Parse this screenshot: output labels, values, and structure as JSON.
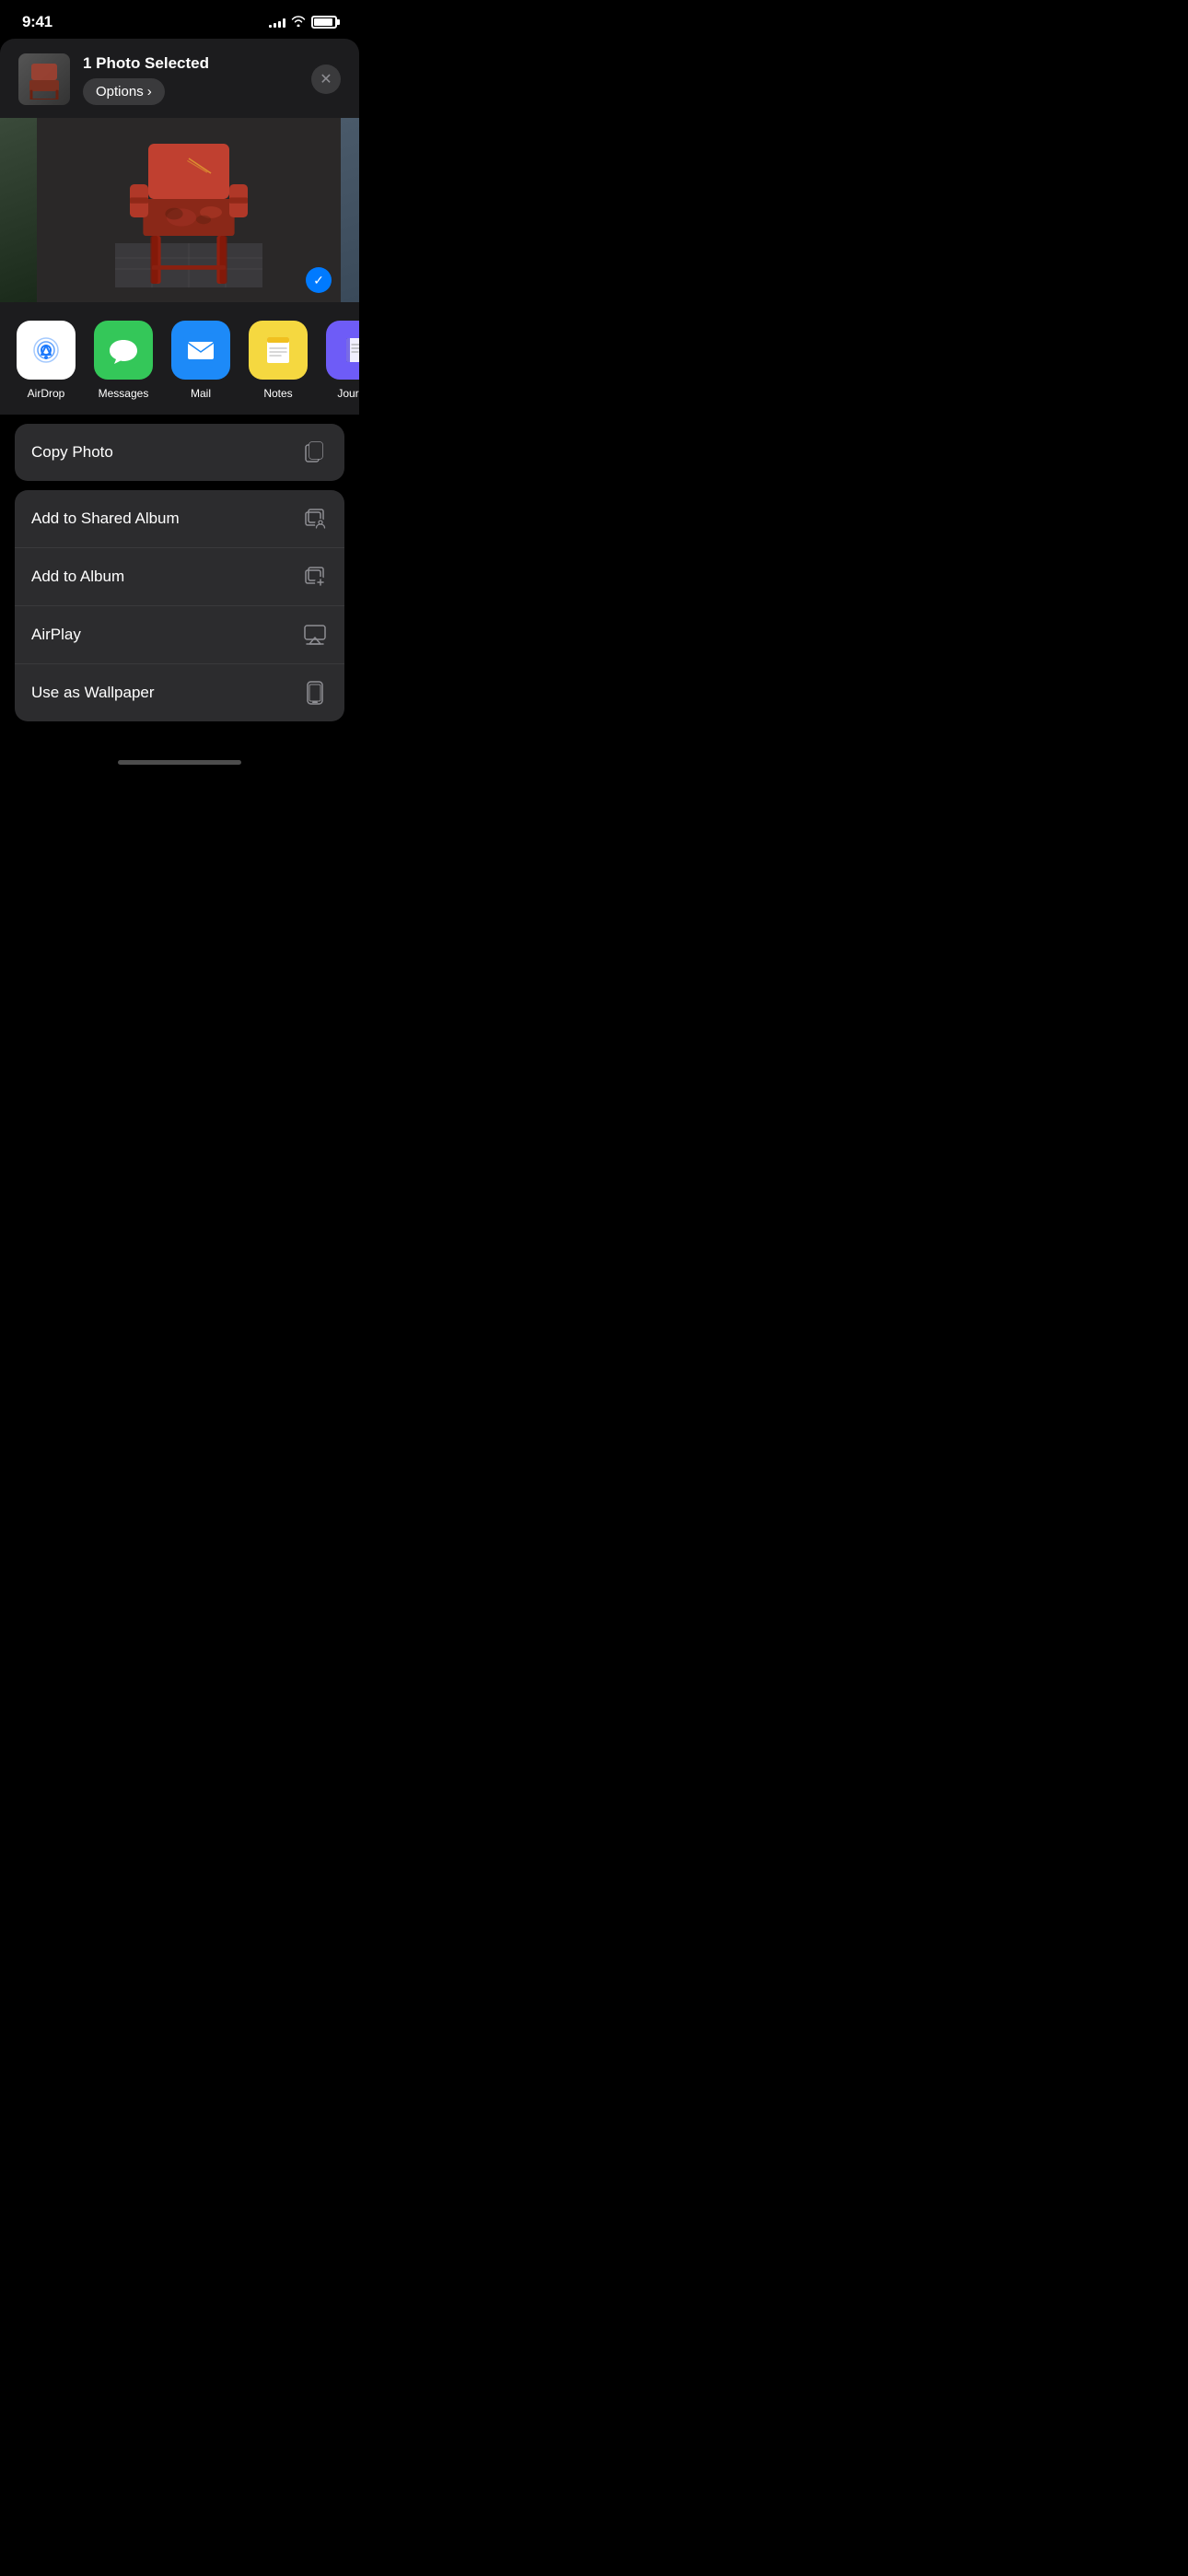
{
  "statusBar": {
    "time": "9:41",
    "battery": 85
  },
  "shareHeader": {
    "title": "1 Photo Selected",
    "optionsLabel": "Options",
    "optionsChevron": "›",
    "closeLabel": "✕"
  },
  "photo": {
    "checkmark": "✓"
  },
  "apps": [
    {
      "id": "airdrop",
      "label": "AirDrop",
      "type": "airdrop"
    },
    {
      "id": "messages",
      "label": "Messages",
      "type": "messages"
    },
    {
      "id": "mail",
      "label": "Mail",
      "type": "mail"
    },
    {
      "id": "notes",
      "label": "Notes",
      "type": "notes"
    },
    {
      "id": "journal",
      "label": "Journal",
      "type": "journal"
    }
  ],
  "actions": {
    "group1": [
      {
        "id": "copy-photo",
        "label": "Copy Photo",
        "icon": "copy"
      }
    ],
    "group2": [
      {
        "id": "add-shared-album",
        "label": "Add to Shared Album",
        "icon": "shared-album"
      },
      {
        "id": "add-album",
        "label": "Add to Album",
        "icon": "add-album"
      },
      {
        "id": "airplay",
        "label": "AirPlay",
        "icon": "airplay"
      },
      {
        "id": "use-wallpaper",
        "label": "Use as Wallpaper",
        "icon": "wallpaper"
      }
    ]
  }
}
